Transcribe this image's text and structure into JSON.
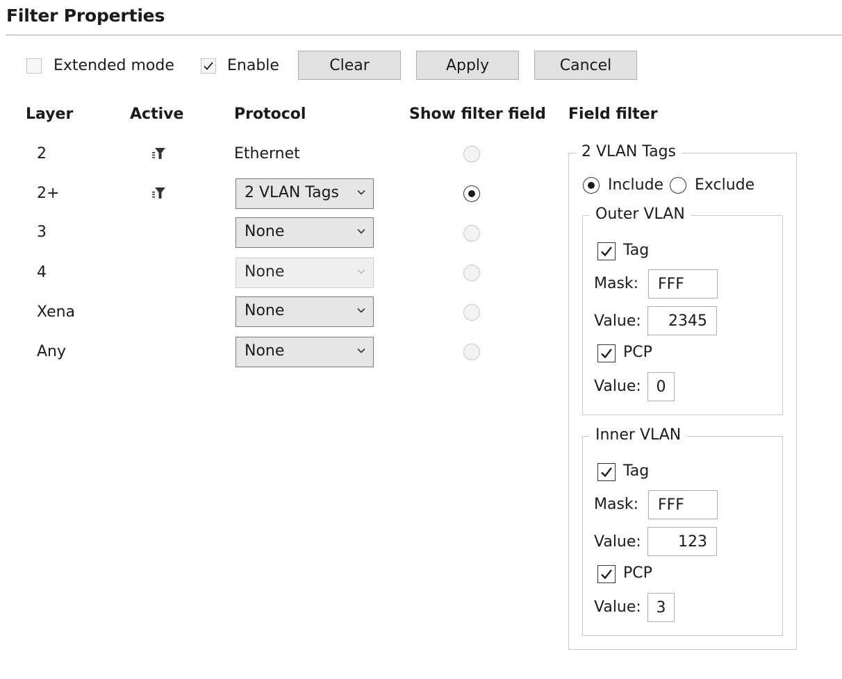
{
  "title": "Filter Properties",
  "toolbar": {
    "extended_mode": {
      "label": "Extended mode",
      "checked": false
    },
    "enable": {
      "label": "Enable",
      "checked": true
    },
    "clear_label": "Clear",
    "apply_label": "Apply",
    "cancel_label": "Cancel"
  },
  "columns": {
    "layer": "Layer",
    "active": "Active",
    "protocol": "Protocol",
    "show_filter_field": "Show filter field",
    "field_filter": "Field filter"
  },
  "rows": [
    {
      "layer": "2",
      "active_icon": "filter-icon",
      "protocol": "Ethernet",
      "protocol_type": "text",
      "show_selected": false
    },
    {
      "layer": "2+",
      "active_icon": "filter-icon",
      "protocol": "2 VLAN Tags",
      "protocol_type": "dropdown",
      "show_selected": true
    },
    {
      "layer": "3",
      "protocol": "None",
      "protocol_type": "dropdown",
      "show_selected": false
    },
    {
      "layer": "4",
      "protocol": "None",
      "protocol_type": "dropdown-disabled",
      "show_selected": false
    },
    {
      "layer": "Xena",
      "protocol": "None",
      "protocol_type": "dropdown",
      "show_selected": false
    },
    {
      "layer": "Any",
      "protocol": "None",
      "protocol_type": "dropdown",
      "show_selected": false
    }
  ],
  "field_filter": {
    "group_title": "2 VLAN Tags",
    "include_label": "Include",
    "exclude_label": "Exclude",
    "mode": "Include",
    "outer": {
      "title": "Outer VLAN",
      "tag_label": "Tag",
      "tag_checked": true,
      "mask_label": "Mask:",
      "mask_value": "FFF",
      "value_label": "Value:",
      "tag_value": "2345",
      "pcp_label": "PCP",
      "pcp_checked": true,
      "pcp_value_label": "Value:",
      "pcp_value": "0"
    },
    "inner": {
      "title": "Inner VLAN",
      "tag_label": "Tag",
      "tag_checked": true,
      "mask_label": "Mask:",
      "mask_value": "FFF",
      "value_label": "Value:",
      "tag_value": "123",
      "pcp_label": "PCP",
      "pcp_checked": true,
      "pcp_value_label": "Value:",
      "pcp_value": "3"
    }
  }
}
